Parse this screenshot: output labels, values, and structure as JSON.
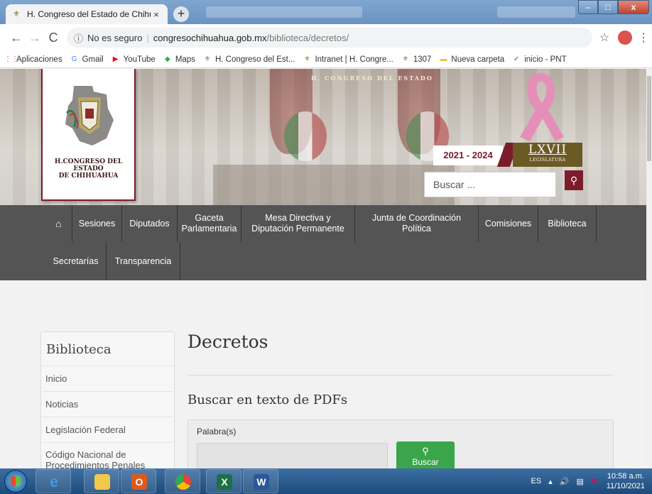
{
  "browser": {
    "tab_title": "H. Congreso del Estado de Chihu",
    "tab_close": "×",
    "new_tab": "+",
    "url_security": "No es seguro",
    "url_domain": "congresochihuahua.gob.mx",
    "url_path": "/biblioteca/decretos/",
    "bookmarks": [
      {
        "label": "Aplicaciones",
        "icon": "apps-grid-icon",
        "color": "#d93025"
      },
      {
        "label": "Gmail",
        "icon": "google-icon",
        "color": "#4285f4"
      },
      {
        "label": "YouTube",
        "icon": "youtube-icon",
        "color": "#ff0000"
      },
      {
        "label": "Maps",
        "icon": "maps-icon",
        "color": "#34a853"
      },
      {
        "label": "H. Congreso del Est...",
        "icon": "congreso-seal-icon",
        "color": "#8b7a3a"
      },
      {
        "label": "Intranet | H. Congre...",
        "icon": "congreso-seal-icon",
        "color": "#8b7a3a"
      },
      {
        "label": "1307",
        "icon": "congreso-seal-icon",
        "color": "#8b7a3a"
      },
      {
        "label": "Nueva carpeta",
        "icon": "folder-icon",
        "color": "#f6c342"
      },
      {
        "label": "inicio - PNT",
        "icon": "pnt-icon",
        "color": "#9c27b0"
      }
    ]
  },
  "header": {
    "hero_caption": "H. CONGRESO DEL ESTADO",
    "logo_line1": "H.CONGRESO DEL ESTADO",
    "logo_line2": "DE CHIHUAHUA",
    "term": "2021 - 2024",
    "legislature": "LXVII",
    "legislature_label": "LEGISLATURA",
    "search_placeholder": "Buscar ..."
  },
  "nav": {
    "row1": [
      "Sesiones",
      "Diputados",
      "Gaceta Parlamentaria",
      "Mesa Directiva y Diputación Permanente",
      "Junta de Coordinación Política",
      "Comisiones",
      "Biblioteca"
    ],
    "row2": [
      "Secretarías",
      "Transparencia"
    ]
  },
  "sidebar": {
    "title": "Biblioteca",
    "items": [
      "Inicio",
      "Noticias",
      "Legislación Federal",
      "Código Nacional de Procedimientos Penales"
    ]
  },
  "main": {
    "title": "Decretos",
    "subtitle": "Buscar en texto de PDFs",
    "field_label": "Palabra(s)",
    "button_label": "Buscar"
  },
  "taskbar": {
    "lang": "ES",
    "time": "10:58 a.m.",
    "date": "11/10/2021"
  },
  "colors": {
    "brand": "#7c1c2a",
    "nav_bg": "#545454",
    "button_green": "#3aa54b"
  }
}
